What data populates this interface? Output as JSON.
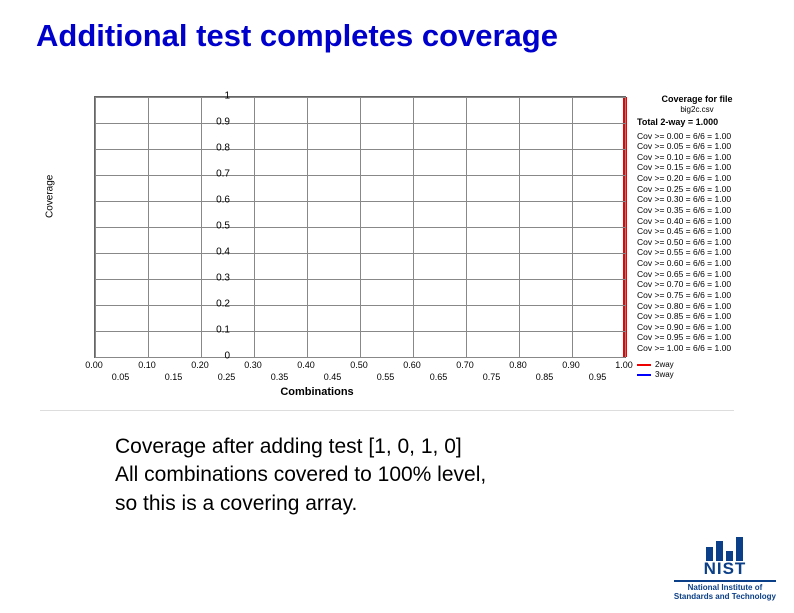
{
  "title": "Additional test completes coverage",
  "caption_line1": "Coverage after adding test [1, 0, 1, 0]",
  "caption_line2": "All combinations covered to 100% level,",
  "caption_line3": "so this is a covering array.",
  "logo": {
    "name": "NIST",
    "sub1": "National Institute of",
    "sub2": "Standards and Technology"
  },
  "panel": {
    "title": "Coverage for file",
    "file": "big2c.csv",
    "total": "Total 2-way = 1.000",
    "rows": [
      "Cov >= 0.00 = 6/6 = 1.00",
      "Cov >= 0.05 = 6/6 = 1.00",
      "Cov >= 0.10 = 6/6 = 1.00",
      "Cov >= 0.15 = 6/6 = 1.00",
      "Cov >= 0.20 = 6/6 = 1.00",
      "Cov >= 0.25 = 6/6 = 1.00",
      "Cov >= 0.30 = 6/6 = 1.00",
      "Cov >= 0.35 = 6/6 = 1.00",
      "Cov >= 0.40 = 6/6 = 1.00",
      "Cov >= 0.45 = 6/6 = 1.00",
      "Cov >= 0.50 = 6/6 = 1.00",
      "Cov >= 0.55 = 6/6 = 1.00",
      "Cov >= 0.60 = 6/6 = 1.00",
      "Cov >= 0.65 = 6/6 = 1.00",
      "Cov >= 0.70 = 6/6 = 1.00",
      "Cov >= 0.75 = 6/6 = 1.00",
      "Cov >= 0.80 = 6/6 = 1.00",
      "Cov >= 0.85 = 6/6 = 1.00",
      "Cov >= 0.90 = 6/6 = 1.00",
      "Cov >= 0.95 = 6/6 = 1.00",
      "Cov >= 1.00 = 6/6 = 1.00"
    ],
    "legend": {
      "s1": "2way",
      "s2": "3way"
    }
  },
  "chart_data": {
    "type": "line",
    "title": "",
    "xlabel": "Combinations",
    "ylabel": "Coverage",
    "xlim": [
      0,
      1
    ],
    "ylim": [
      0,
      1
    ],
    "xticks_top": [
      "0.00",
      "0.10",
      "0.20",
      "0.30",
      "0.40",
      "0.50",
      "0.60",
      "0.70",
      "0.80",
      "0.90",
      "1.00"
    ],
    "xticks_bottom": [
      "0.05",
      "0.15",
      "0.25",
      "0.35",
      "0.45",
      "0.55",
      "0.65",
      "0.75",
      "0.85",
      "0.95"
    ],
    "yticks": [
      "0",
      "0.1",
      "0.2",
      "0.3",
      "0.4",
      "0.5",
      "0.6",
      "0.7",
      "0.8",
      "0.9",
      "1"
    ],
    "series": [
      {
        "name": "2way",
        "color": "#e00",
        "points": [
          [
            1.0,
            0.0
          ],
          [
            1.0,
            1.0
          ]
        ]
      },
      {
        "name": "3way",
        "color": "#00f",
        "points": []
      }
    ]
  }
}
